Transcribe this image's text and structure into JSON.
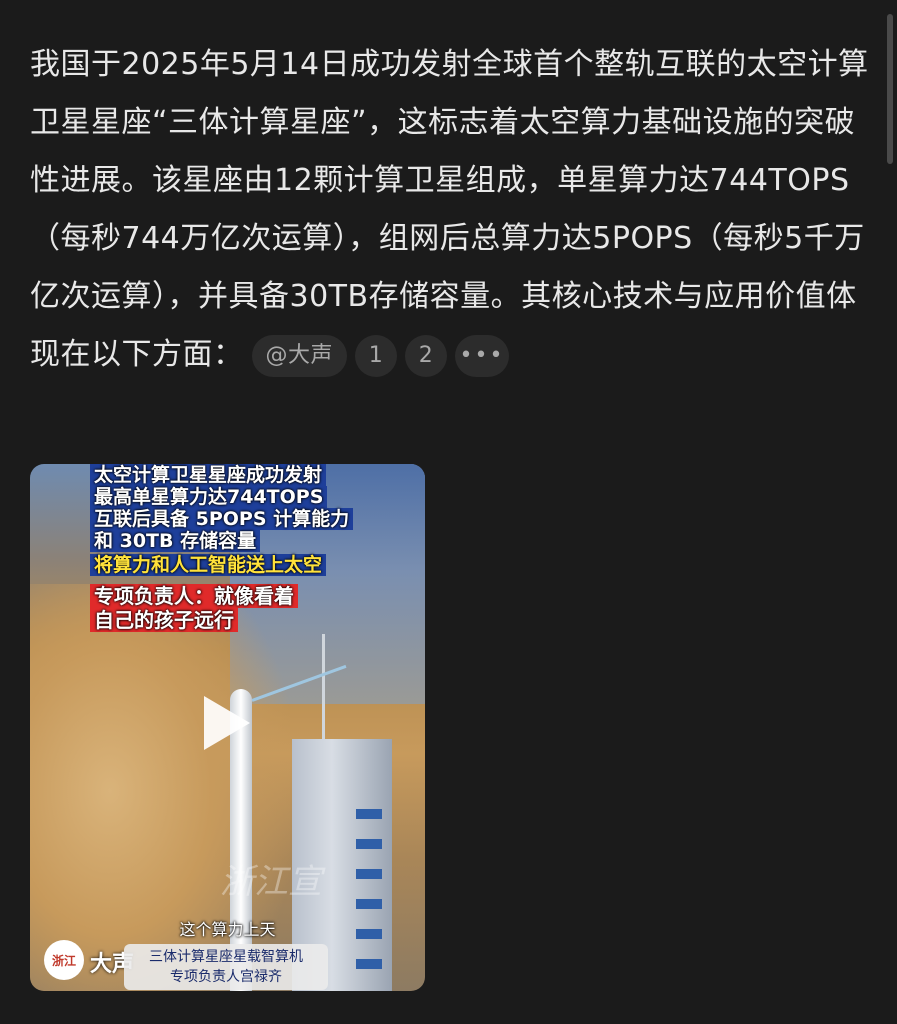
{
  "post": {
    "body": "我国于2025年5月14日成功发射全球首个整轨互联的太空计算卫星星座“三体计算星座”，这标志着太空算力基础设施的突破性进展。该星座由12颗计算卫星组成，单星算力达744TOPS（每秒744万亿次运算），组网后总算力达5POPS（每秒5千万亿次运算），并具备30TB存储容量。其核心技术与应用价值体现在以下方面：",
    "mention": "@大声",
    "refs": [
      "1",
      "2"
    ],
    "more": "•••"
  },
  "video": {
    "overlay_lines": [
      "太空计算卫星星座成功发射",
      "最高单星算力达744TOPS",
      "互联后具备 5POPS 计算能力",
      "和 30TB 存储容量"
    ],
    "highlight": "将算力和人工智能送上太空",
    "quote_lines": [
      "专项负责人：就像看着",
      "自己的孩子远行"
    ],
    "subtitle": "这个算力上天",
    "watermark": "浙江宣",
    "logo_mark": "浙江",
    "channel": "大声",
    "caption_lines": [
      "三体计算星座星载智算机",
      "专项负责人宫禄齐"
    ]
  }
}
